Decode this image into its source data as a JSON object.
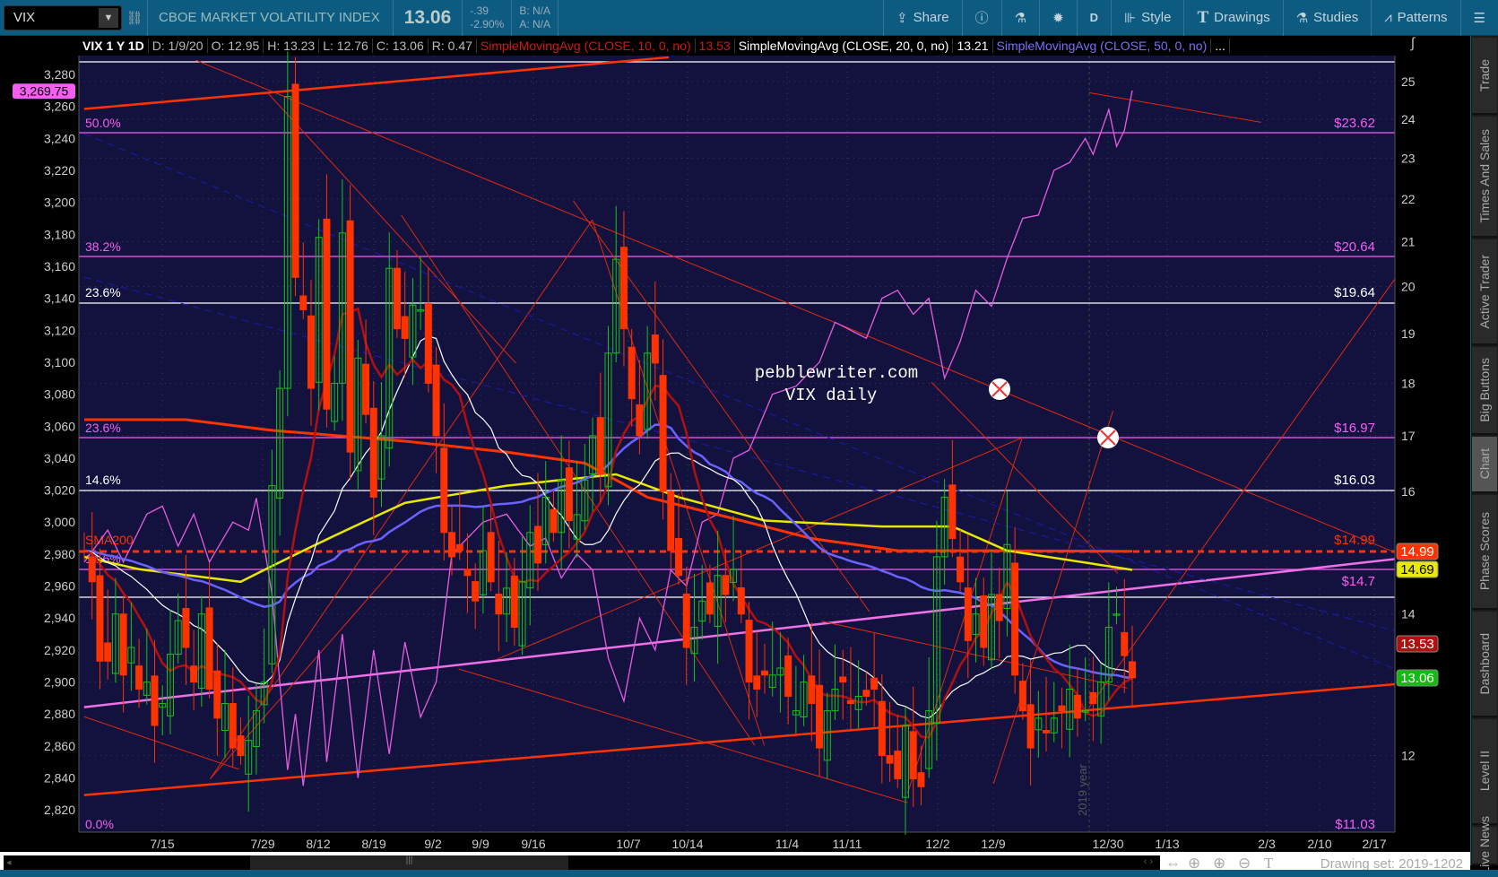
{
  "toolbar": {
    "symbol": "VIX",
    "title": "CBOE MARKET VOLATILITY INDEX",
    "price": "13.06",
    "change": "-.39",
    "change_pct": "-2.90%",
    "bid": "B: N/A",
    "ask": "A: N/A",
    "buttons": [
      {
        "label": "Share",
        "icon": "share-icon"
      },
      {
        "label": "",
        "icon": "info-icon"
      },
      {
        "label": "",
        "icon": "flask-icon"
      },
      {
        "label": "",
        "icon": "gear-icon"
      },
      {
        "label": "D",
        "icon": ""
      },
      {
        "label": "Style",
        "icon": "candle-icon"
      },
      {
        "label": "Drawings",
        "icon": "text-t-icon"
      },
      {
        "label": "Studies",
        "icon": "flask-icon"
      },
      {
        "label": "Patterns",
        "icon": "pattern-icon"
      },
      {
        "label": "",
        "icon": "list-icon"
      }
    ]
  },
  "legend": {
    "symbol": "VIX 1 Y 1D",
    "date": "D: 1/9/20",
    "open": "O: 12.95",
    "high": "H: 13.23",
    "low": "L: 12.76",
    "close": "C: 13.06",
    "range": "R: 0.47",
    "sma10": "SimpleMovingAvg (CLOSE, 10, 0, no)",
    "sma10_val": "13.53",
    "sma20": "SimpleMovingAvg (CLOSE, 20, 0, no)",
    "sma20_val": "13.21",
    "sma50": "SimpleMovingAvg (CLOSE, 50, 0, no)",
    "more": "..."
  },
  "chart_data": {
    "type": "candlestick",
    "left_axis": {
      "ticks": [
        "3,280",
        "3,260",
        "3,240",
        "3,220",
        "3,200",
        "3,180",
        "3,160",
        "3,140",
        "3,120",
        "3,100",
        "3,080",
        "3,060",
        "3,040",
        "3,020",
        "3,000",
        "2,980",
        "2,960",
        "2,940",
        "2,920",
        "2,900",
        "2,880",
        "2,860",
        "2,840",
        "2,820"
      ],
      "range": [
        2820,
        3280
      ],
      "badge": "3,269.75"
    },
    "right_axis": {
      "ticks": [
        "25",
        "24",
        "23",
        "22",
        "21",
        "20",
        "19",
        "18",
        "17",
        "16",
        "14",
        "12"
      ],
      "range": [
        11,
        25
      ],
      "scale": "log"
    },
    "x_labels": [
      "7/15",
      "7/29",
      "8/12",
      "8/19",
      "9/2",
      "9/9",
      "9/16",
      "10/7",
      "10/14",
      "11/4",
      "11/11",
      "12/2",
      "12/9",
      "12/30",
      "1/13",
      "2/3",
      "2/10",
      "2/17"
    ],
    "vix_close": [
      15.0,
      14.5,
      13.3,
      13.3,
      14.0,
      13.1,
      13.5,
      12.9,
      13.0,
      12.4,
      12.7,
      13.4,
      13.9,
      13.5,
      13.0,
      14.0,
      12.9,
      12.5,
      12.7,
      12.1,
      12.0,
      12.2,
      12.6,
      13.0,
      16.1,
      17.9,
      24.6,
      20.2,
      19.5,
      17.9,
      21.1,
      17.5,
      18.0,
      21.2,
      16.7,
      18.5,
      17.4,
      15.9,
      17.0,
      20.4,
      19.1,
      18.9,
      19.6,
      19.5,
      18.0,
      17.0,
      15.3,
      14.9,
      15.0,
      14.6,
      14.2,
      15.0,
      14.5,
      14.0,
      14.4,
      13.8,
      14.5,
      15.3,
      14.8,
      15.9,
      15.3,
      16.2,
      15.5,
      15.6,
      16.2,
      17.0,
      16.3,
      18.6,
      20.6,
      19.1,
      17.7,
      17.0,
      18.6,
      18.4,
      16.0,
      15.0,
      14.6,
      13.5,
      13.8,
      14.2,
      14.0,
      14.6,
      14.3,
      14.7,
      14.0,
      13.0,
      12.9,
      13.1,
      13.1,
      13.2,
      12.8,
      12.6,
      13.0,
      12.7,
      12.1,
      12.6,
      12.9,
      13.0,
      12.7,
      12.8,
      12.8,
      12.9,
      12.0,
      11.9,
      11.7,
      12.4,
      11.7,
      11.6,
      12.6,
      14.9,
      15.9,
      15.2,
      14.5,
      13.6,
      14.0,
      13.5,
      14.3,
      13.9,
      15.1,
      13.1,
      12.6,
      12.1,
      12.5,
      12.3,
      12.5,
      12.6,
      12.9,
      12.5,
      12.6,
      12.7,
      13.0,
      13.8,
      14.0,
      13.38,
      13.06
    ],
    "spx_points": [
      [
        0,
        2975
      ],
      [
        3,
        2995
      ],
      [
        5,
        2975
      ],
      [
        8,
        3005
      ],
      [
        10,
        3010
      ],
      [
        12,
        2985
      ],
      [
        14,
        3005
      ],
      [
        16,
        2975
      ],
      [
        19,
        3000
      ],
      [
        21,
        2995
      ],
      [
        22,
        3015
      ],
      [
        24,
        2955
      ],
      [
        26,
        2845
      ],
      [
        27,
        2880
      ],
      [
        28,
        2835
      ],
      [
        30,
        2920
      ],
      [
        31,
        2850
      ],
      [
        33,
        2930
      ],
      [
        35,
        2840
      ],
      [
        37,
        2920
      ],
      [
        39,
        2855
      ],
      [
        41,
        2925
      ],
      [
        43,
        2878
      ],
      [
        45,
        2900
      ],
      [
        47,
        2980
      ],
      [
        49,
        2990
      ],
      [
        51,
        3000
      ],
      [
        54,
        3005
      ],
      [
        57,
        2985
      ],
      [
        59,
        2990
      ],
      [
        61,
        2965
      ],
      [
        63,
        2980
      ],
      [
        65,
        2970
      ],
      [
        67,
        2915
      ],
      [
        69,
        2888
      ],
      [
        71,
        2940
      ],
      [
        73,
        2920
      ],
      [
        75,
        2970
      ],
      [
        77,
        2960
      ],
      [
        79,
        3000
      ],
      [
        81,
        3005
      ],
      [
        83,
        3040
      ],
      [
        85,
        3045
      ],
      [
        88,
        3080
      ],
      [
        91,
        3085
      ],
      [
        94,
        3100
      ],
      [
        96,
        3125
      ],
      [
        98,
        3120
      ],
      [
        100,
        3115
      ],
      [
        102,
        3140
      ],
      [
        104,
        3145
      ],
      [
        106,
        3130
      ],
      [
        108,
        3140
      ],
      [
        110,
        3090
      ],
      [
        112,
        3113
      ],
      [
        114,
        3145
      ],
      [
        116,
        3135
      ],
      [
        118,
        3165
      ],
      [
        120,
        3190
      ],
      [
        122,
        3192
      ],
      [
        124,
        3220
      ],
      [
        126,
        3225
      ],
      [
        128,
        3240
      ],
      [
        129,
        3230
      ],
      [
        131,
        3258
      ],
      [
        132,
        3235
      ],
      [
        133,
        3245
      ],
      [
        134,
        3270
      ]
    ],
    "sma200_points": [
      [
        0,
        17.3
      ],
      [
        13,
        17.3
      ],
      [
        24,
        17.1
      ],
      [
        41,
        16.9
      ],
      [
        54,
        16.7
      ],
      [
        64,
        16.5
      ],
      [
        72,
        15.9
      ],
      [
        81,
        15.6
      ],
      [
        93,
        15.2
      ],
      [
        104,
        15.0
      ],
      [
        116,
        15.0
      ],
      [
        134,
        14.99
      ]
    ],
    "yellow_points": [
      [
        0,
        14.9
      ],
      [
        7,
        14.7
      ],
      [
        20,
        14.5
      ],
      [
        28,
        15.0
      ],
      [
        41,
        15.8
      ],
      [
        54,
        16.1
      ],
      [
        68,
        16.3
      ],
      [
        76,
        15.9
      ],
      [
        87,
        15.5
      ],
      [
        102,
        15.4
      ],
      [
        111,
        15.4
      ],
      [
        118,
        15.0
      ],
      [
        134,
        14.69
      ]
    ],
    "fib_left_labels": [
      "50.0%",
      "38.2%",
      "23.6%",
      "23.6%",
      "14.6%",
      "SMA200",
      "14.6%",
      "0.0%"
    ],
    "fib_right_labels": [
      "$23.62",
      "$20.64",
      "$19.64",
      "$16.97",
      "$16.03",
      "$14.99",
      "$14.7",
      "$11.03"
    ],
    "price_badges": [
      {
        "value": "14.99",
        "color": "#ff3300"
      },
      {
        "value": "14.69",
        "color": "#e8e800"
      },
      {
        "value": "13.53",
        "color": "#b01010"
      },
      {
        "value": "13.06",
        "color": "#11bb11"
      }
    ],
    "annotation": [
      "pebblewriter.com",
      "VIX daily"
    ],
    "year_label": "2019 year"
  },
  "sidebar": {
    "tabs": [
      "Trade",
      "Times And Sales",
      "Active Trader",
      "Big Buttons",
      "Chart",
      "Phase Scores",
      "Dashboard",
      "Level II",
      "Live News"
    ],
    "active": "Chart"
  },
  "footer": {
    "drawing_set": "Drawing set: 2019-1202",
    "scroll_grip": "|||"
  }
}
